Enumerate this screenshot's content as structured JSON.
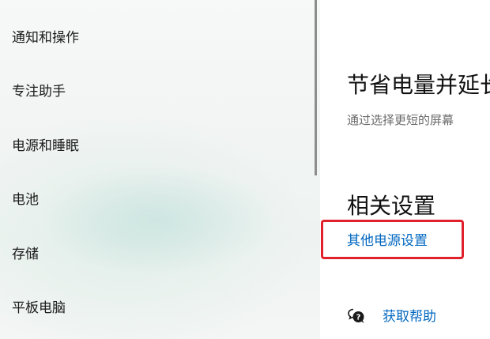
{
  "sidebar": {
    "items": [
      {
        "label": "通知和操作"
      },
      {
        "label": "专注助手"
      },
      {
        "label": "电源和睡眠"
      },
      {
        "label": "电池"
      },
      {
        "label": "存储"
      },
      {
        "label": "平板电脑"
      }
    ]
  },
  "main": {
    "save_power": {
      "title": "节省电量并延长",
      "description": "通过选择更短的屏幕"
    },
    "related": {
      "title": "相关设置",
      "link": "其他电源设置"
    },
    "help": {
      "icon": "help-chat-icon",
      "label": "获取帮助"
    }
  },
  "colors": {
    "link": "#0067c0",
    "highlight": "#e0202a"
  }
}
